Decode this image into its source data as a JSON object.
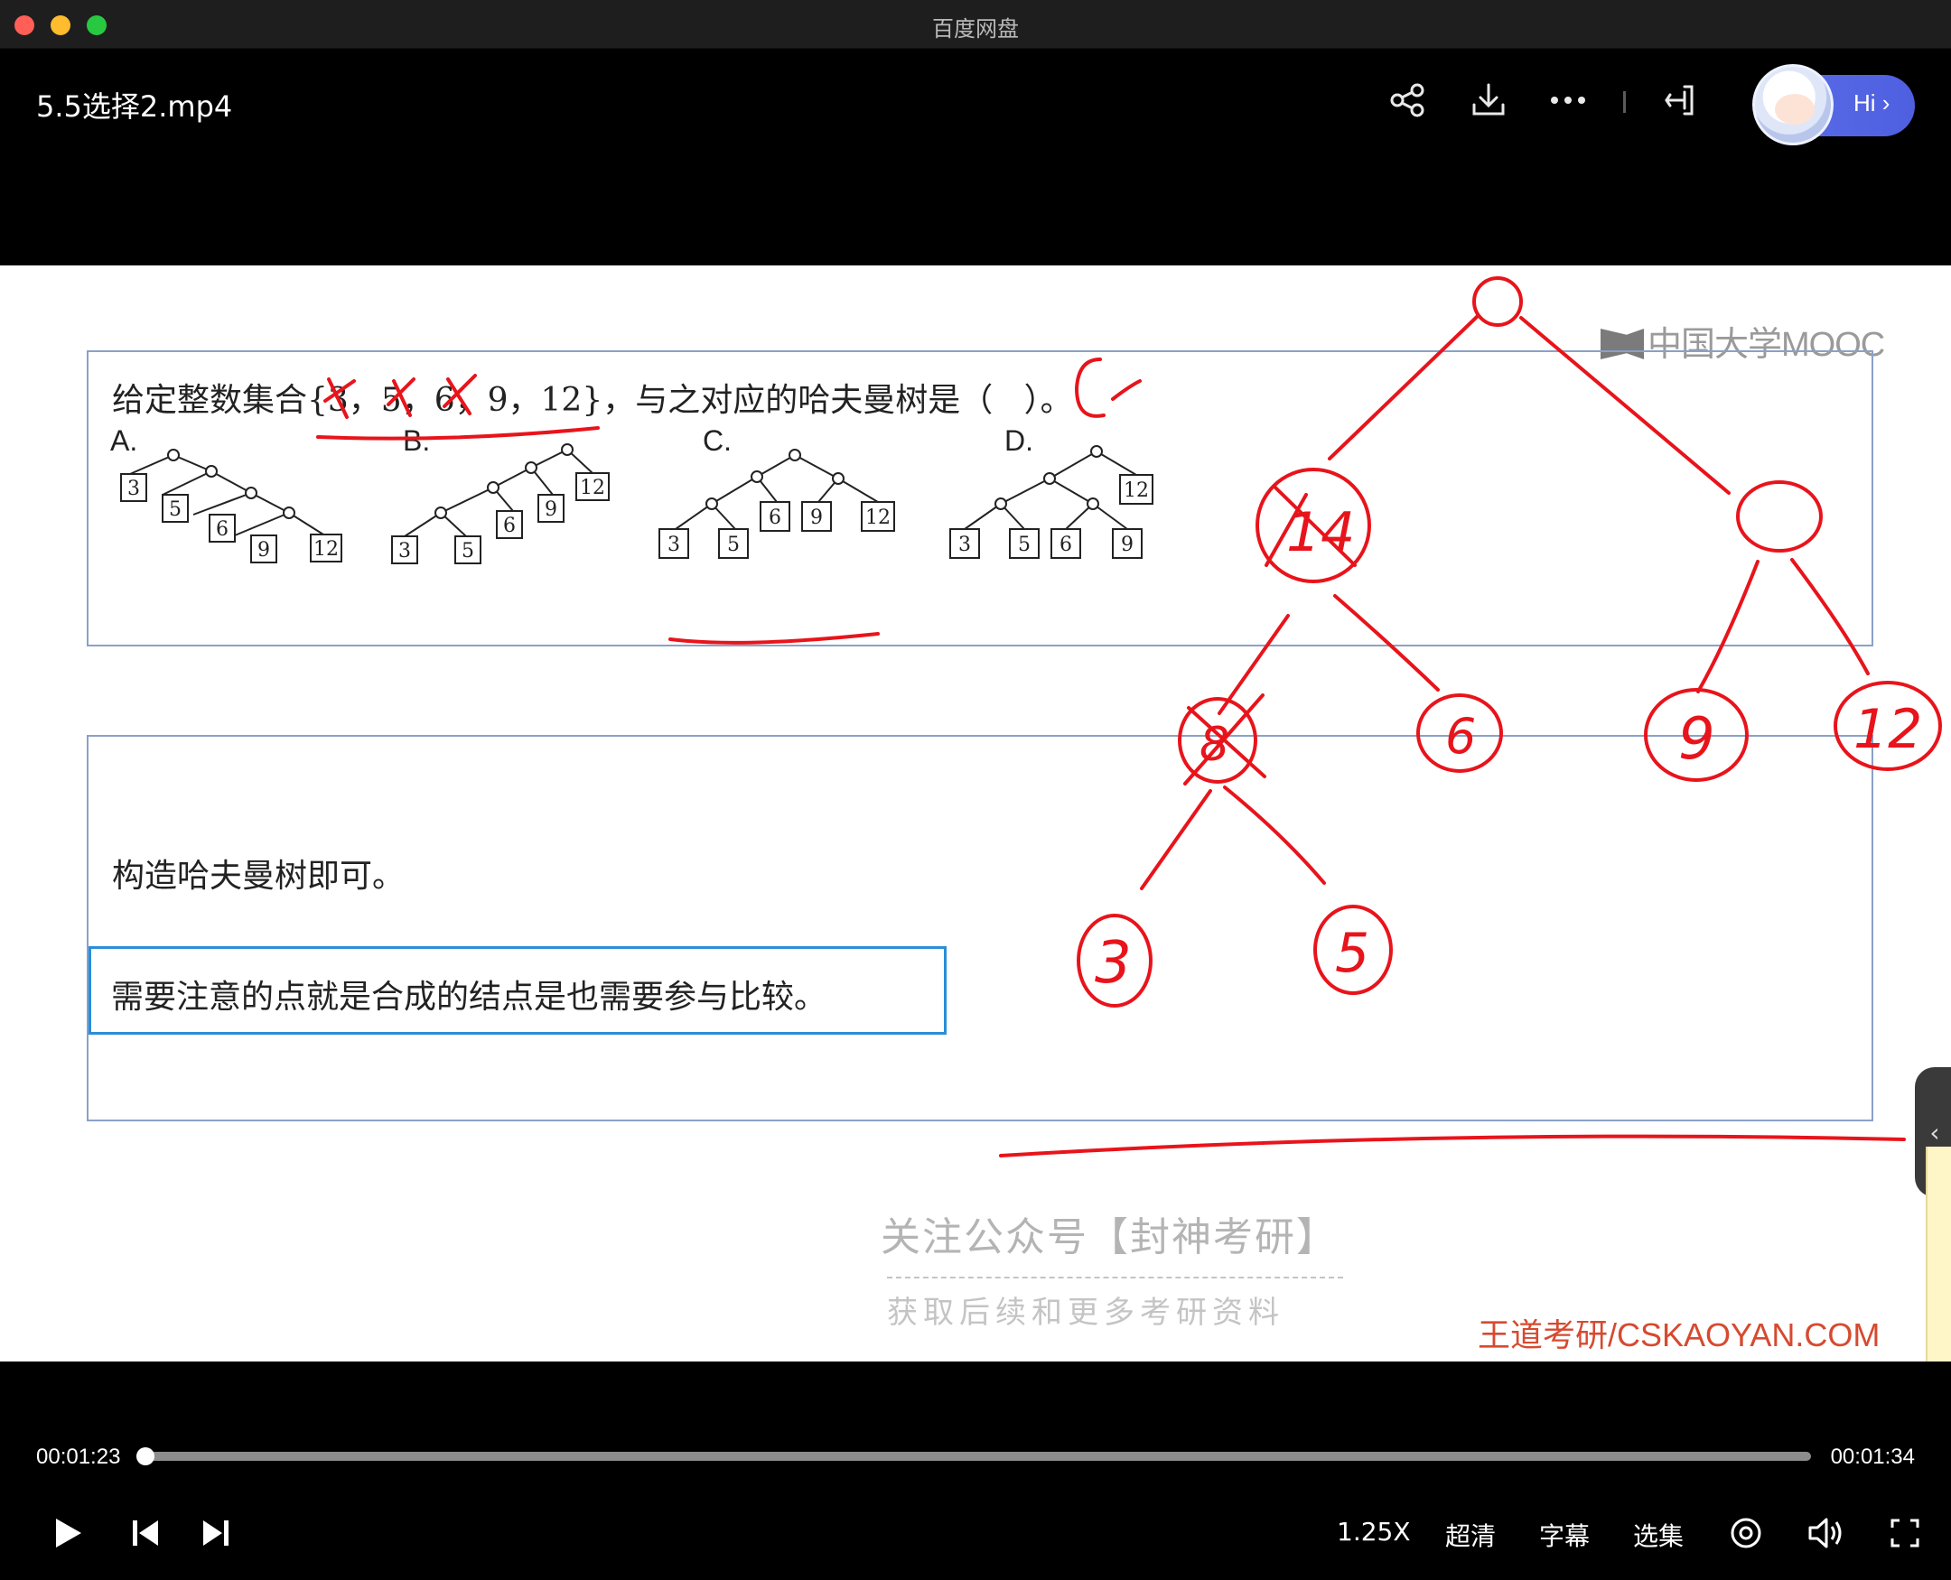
{
  "window": {
    "title": "百度网盘"
  },
  "header": {
    "file_title": "5.5选择2.mp4",
    "icons": [
      "share-icon",
      "download-icon",
      "more-icon",
      "pip-icon"
    ],
    "assistant_label": "Hi ›"
  },
  "slide": {
    "question": "给定整数集合{3，5，6，9，12}，与之对应的哈夫曼树是（   ）。",
    "options": [
      "A.",
      "B.",
      "C.",
      "D."
    ],
    "trees": {
      "A": [
        "3",
        "5",
        "6",
        "9",
        "12"
      ],
      "B": [
        "3",
        "5",
        "6",
        "9",
        "12"
      ],
      "C": [
        "3",
        "5",
        "6",
        "9",
        "12"
      ],
      "D": [
        "3",
        "5",
        "6",
        "9",
        "12"
      ]
    },
    "answer_text": "构造哈夫曼树即可。",
    "note_text": "需要注意的点就是合成的结点是也需要参与比较。",
    "watermark_mooc": "中国大学MOOC",
    "watermark_public": "关注公众号【封神考研】",
    "watermark_sub": "获取后续和更多考研资料",
    "watermark_site": "王道考研/CSKAOYAN.COM",
    "handwriting": {
      "answer": "C",
      "nodes": [
        "14",
        "8",
        "6",
        "9",
        "12",
        "3",
        "5"
      ]
    }
  },
  "player": {
    "current_time": "00:01:23",
    "total_time": "00:01:34",
    "progress": 0.005,
    "speed": "1.25X",
    "quality": "超清",
    "subtitle": "字幕",
    "episodes": "选集"
  },
  "colors": {
    "ink": "#e8141b",
    "note_border": "#2a8ed8",
    "accent": "#5b6ee8"
  }
}
